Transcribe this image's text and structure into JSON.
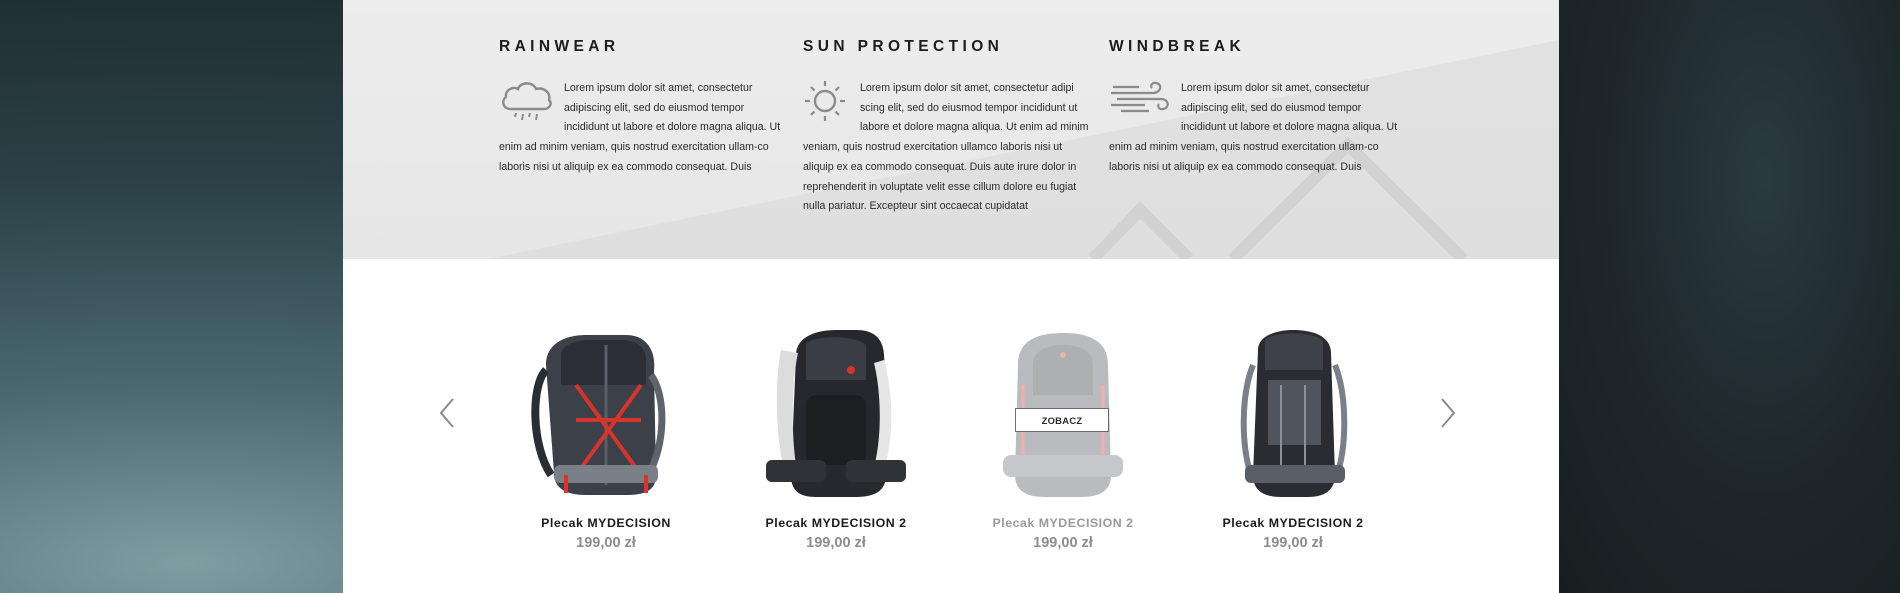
{
  "features": [
    {
      "title": "RAINWEAR",
      "icon": "rain-cloud-icon",
      "text": "Lorem ipsum dolor sit amet, consectetur adipiscing elit, sed do eiusmod tempor incididunt ut labore et dolore magna aliqua. Ut enim ad minim veniam, quis nostrud exercitation ullam-co laboris nisi ut aliquip ex ea commodo consequat. Duis"
    },
    {
      "title": "SUN PROTECTION",
      "icon": "sun-icon",
      "text": "Lorem ipsum dolor sit amet, consectetur adipi scing elit, sed do eiusmod tempor incididunt ut labore et dolore magna aliqua. Ut enim ad minim veniam, quis nostrud exercitation ullamco laboris nisi ut aliquip ex ea commodo consequat. Duis aute irure dolor in reprehenderit in voluptate velit esse cillum dolore eu fugiat nulla pariatur. Excepteur sint occaecat cupidatat"
    },
    {
      "title": "WINDBREAK",
      "icon": "wind-icon",
      "text": "Lorem ipsum dolor sit amet, consectetur adipiscing elit, sed do eiusmod tempor incididunt ut labore et dolore magna aliqua. Ut enim ad minim veniam, quis nostrud exercitation ullam-co laboris nisi ut aliquip ex ea commodo consequat. Duis"
    }
  ],
  "carousel": {
    "prev_icon": "chevron-left-icon",
    "next_icon": "chevron-right-icon",
    "hover_button_label": "ZOBACZ",
    "products": [
      {
        "name": "Plecak MYDECISION",
        "price": "199,00 zł",
        "image": "backpack-red-straps",
        "faded": false
      },
      {
        "name": "Plecak MYDECISION 2",
        "price": "199,00 zł",
        "image": "backpack-black-white",
        "faded": false
      },
      {
        "name": "Plecak MYDECISION 2",
        "price": "199,00 zł",
        "image": "backpack-grey-hovered",
        "faded": true
      },
      {
        "name": "Plecak MYDECISION 2",
        "price": "199,00 zł",
        "image": "backpack-black-trekking",
        "faded": false
      }
    ]
  },
  "colors": {
    "feature_band": "#e9e9e9",
    "text_dark": "#1c1c1c",
    "price_grey": "#8c8c8c",
    "backpack_red": "#d8342c"
  }
}
